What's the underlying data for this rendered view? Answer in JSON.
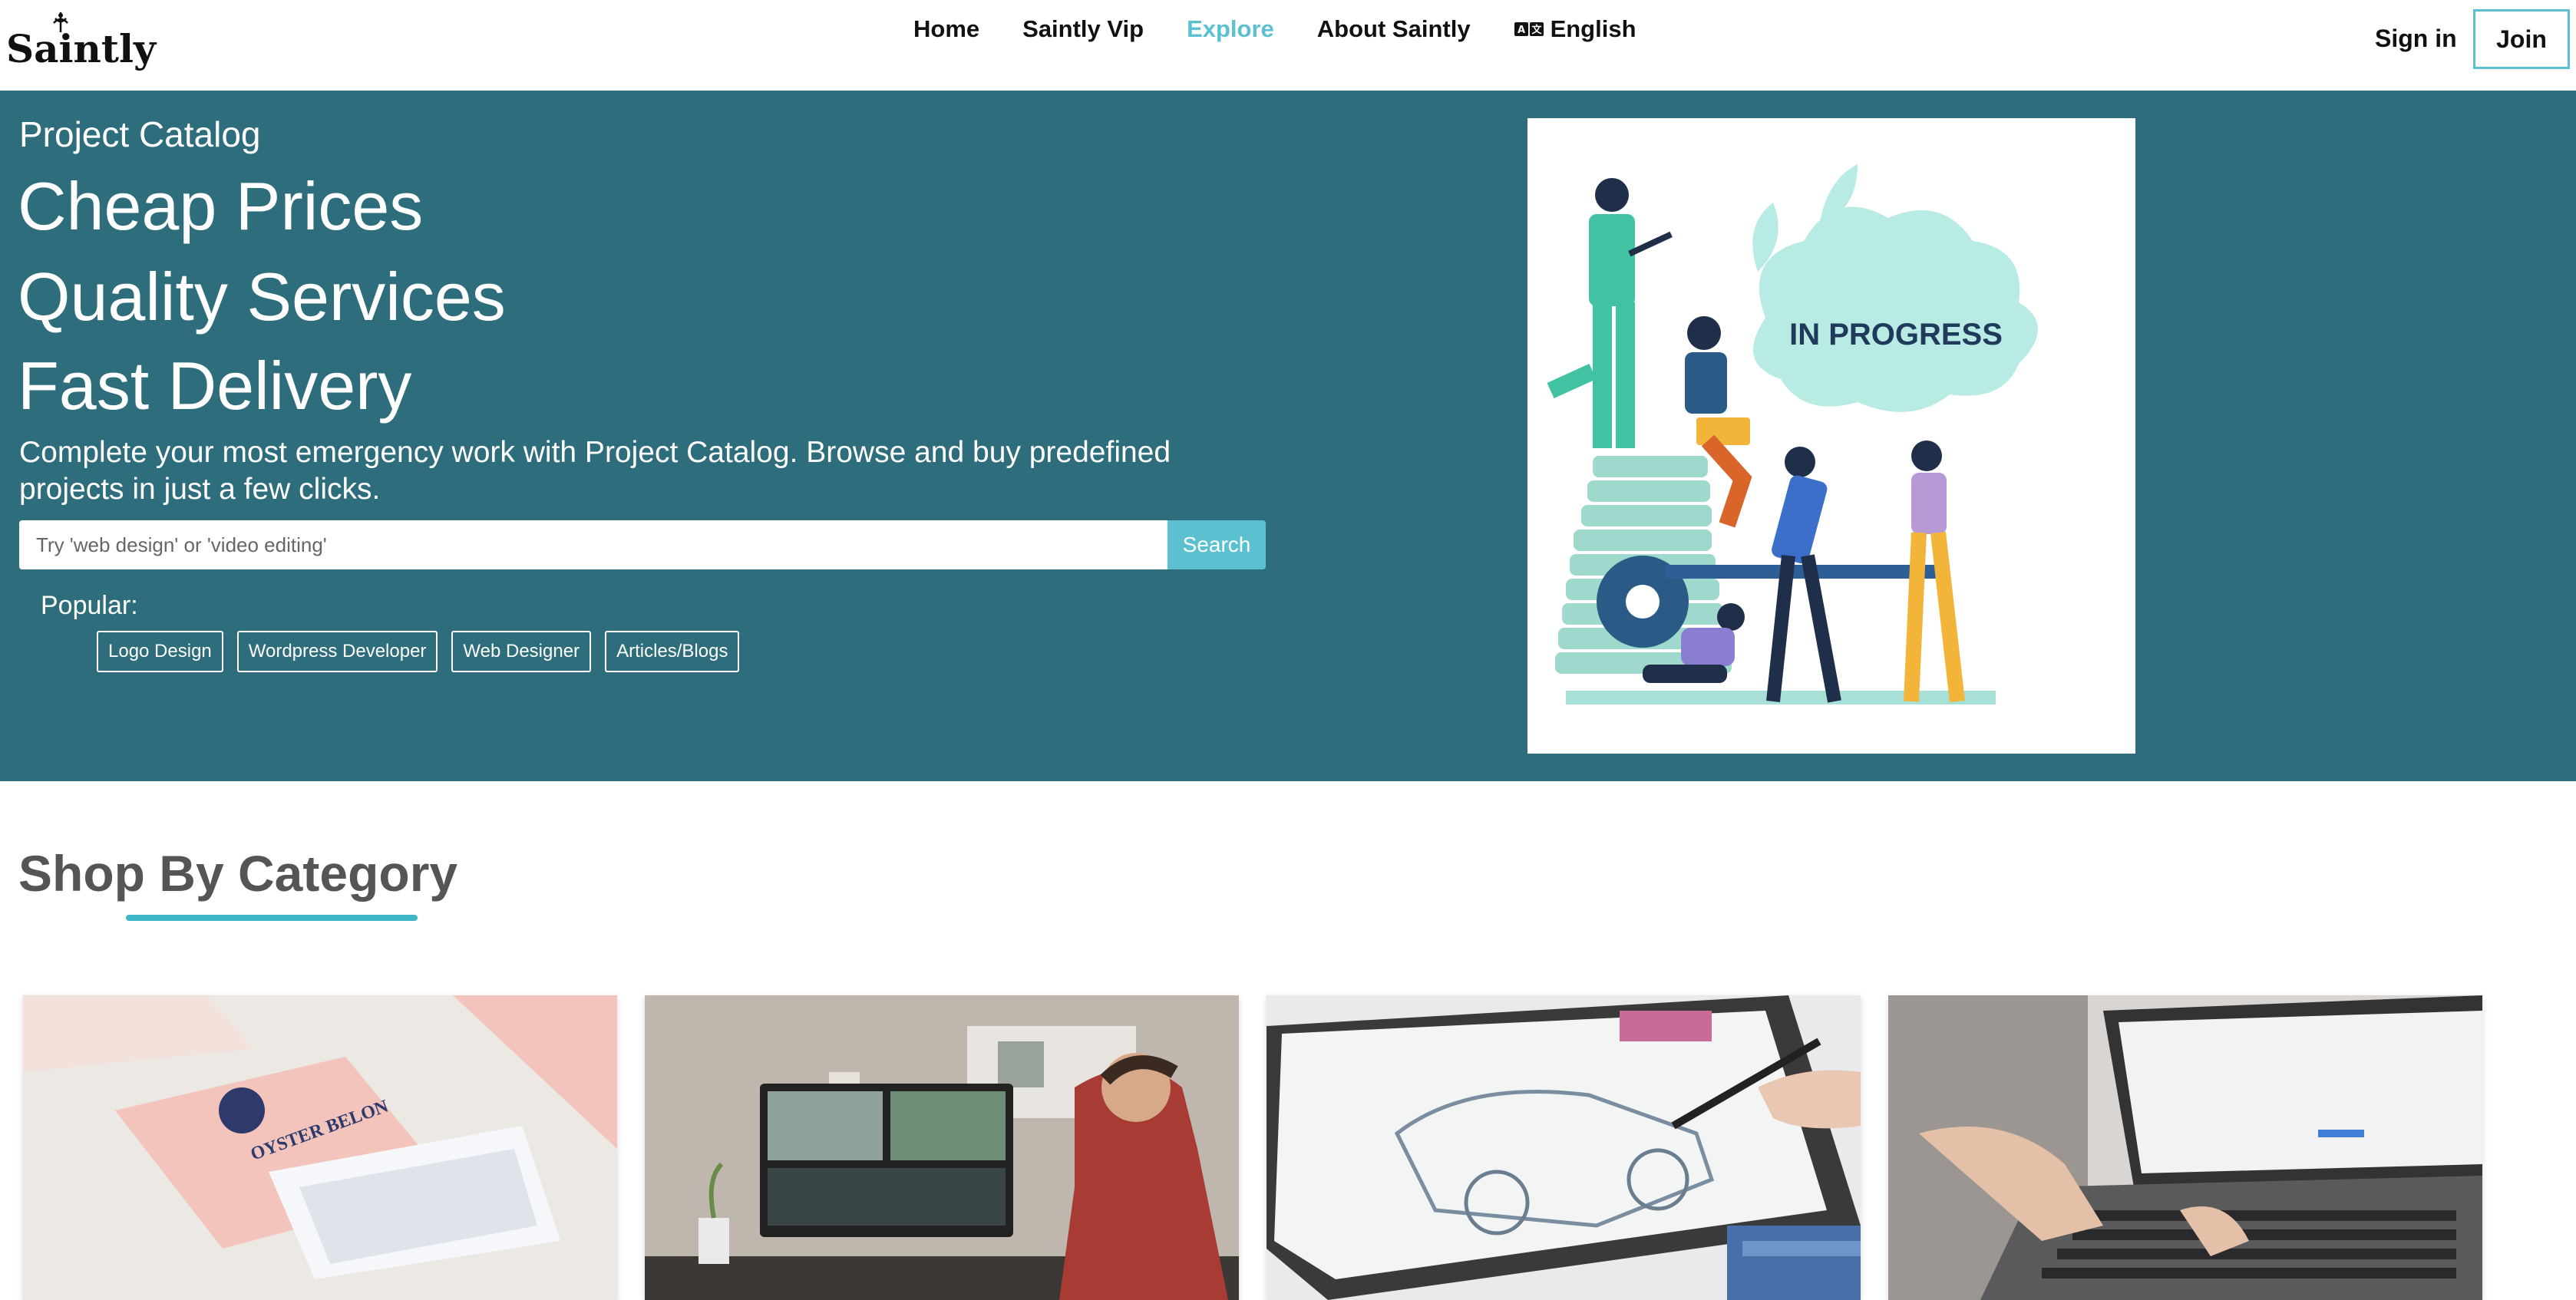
{
  "header": {
    "logo_text": "Saintly",
    "nav": [
      {
        "label": "Home",
        "active": false
      },
      {
        "label": "Saintly Vip",
        "active": false
      },
      {
        "label": "Explore",
        "active": true
      },
      {
        "label": "About Saintly",
        "active": false
      },
      {
        "label": "English",
        "active": false,
        "icon": "language-icon"
      }
    ],
    "sign_in": "Sign in",
    "join": "Join"
  },
  "hero": {
    "eyebrow": "Project Catalog",
    "lines": [
      "Cheap Prices",
      "Quality Services",
      "Fast Delivery"
    ],
    "description": "Complete your most emergency work with Project Catalog. Browse and buy predefined projects in just a few clicks.",
    "search": {
      "placeholder": "Try 'web design' or 'video editing'",
      "button": "Search"
    },
    "popular_label": "Popular:",
    "popular_tags": [
      "Logo Design",
      "Wordpress Developer",
      "Web Designer",
      "Articles/Blogs"
    ],
    "illustration_text": "IN PROGRESS"
  },
  "category": {
    "title": "Shop By Category",
    "cards": [
      {
        "subject": "logo-packaging-photo",
        "text": "OYSTER BELON"
      },
      {
        "subject": "video-editing-photo"
      },
      {
        "subject": "drawing-tablet-photo"
      },
      {
        "subject": "laptop-typing-photo"
      }
    ]
  },
  "colors": {
    "hero_bg": "#2e6d7b",
    "accent": "#5bc0d0"
  }
}
